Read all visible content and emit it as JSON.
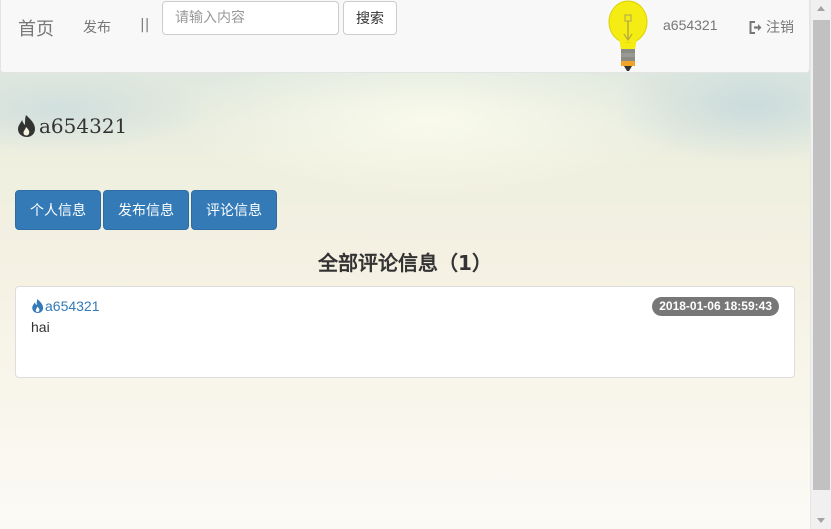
{
  "navbar": {
    "brand": "首页",
    "publish_link": "发布",
    "separator": "||",
    "search_placeholder": "请输入内容",
    "search_button": "搜索",
    "username": "a654321",
    "logout_label": "注销",
    "bulb_color": "#f7f01a"
  },
  "profile": {
    "username": "a654321",
    "icon": "fire-icon"
  },
  "tabs": [
    {
      "label": "个人信息"
    },
    {
      "label": "发布信息"
    },
    {
      "label": "评论信息"
    }
  ],
  "section": {
    "title": "全部评论信息（1）"
  },
  "comments": [
    {
      "user": "a654321",
      "time": "2018-01-06 18:59:43",
      "content": "hai"
    }
  ],
  "colors": {
    "primary": "#337ab7",
    "badge": "#777777"
  }
}
